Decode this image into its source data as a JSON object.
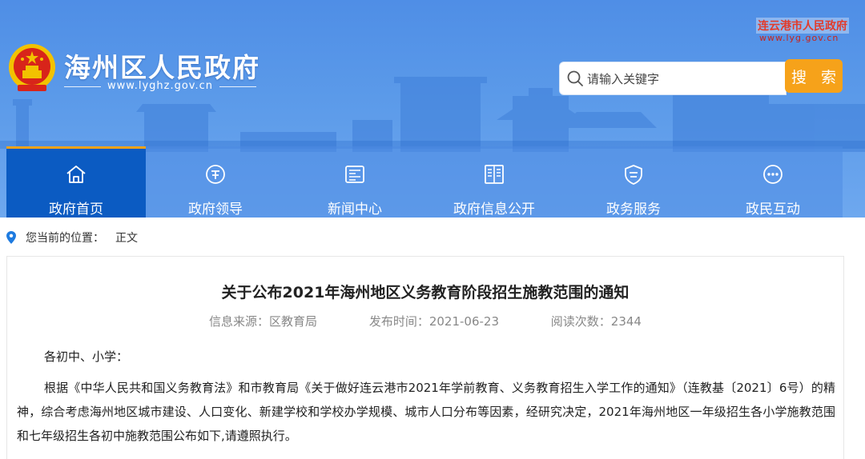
{
  "header": {
    "site_title": "海州区人民政府",
    "site_url": "www.lyghz.gov.cn",
    "city_link": {
      "name": "连云港市人民政府",
      "url": "www.lyg.gov.cn"
    },
    "search": {
      "placeholder": "请输入关键字",
      "button_label": "搜 索"
    }
  },
  "nav": {
    "items": [
      {
        "label": "政府首页",
        "icon": "home-icon",
        "active": true
      },
      {
        "label": "政府领导",
        "icon": "leader-icon"
      },
      {
        "label": "新闻中心",
        "icon": "news-icon"
      },
      {
        "label": "政府信息公开",
        "icon": "info-open-icon"
      },
      {
        "label": "政务服务",
        "icon": "service-shield-icon"
      },
      {
        "label": "政民互动",
        "icon": "chat-icon"
      }
    ]
  },
  "breadcrumb": {
    "prefix": "您当前的位置：",
    "current": "正文"
  },
  "article": {
    "title": "关于公布2021年海州地区义务教育阶段招生施教范围的通知",
    "source": "信息来源：区教育局",
    "date": "发布时间：2021-06-23",
    "views": "阅读次数：2344",
    "greeting": "各初中、小学：",
    "paragraph": "根据《中华人民共和国义务教育法》和市教育局《关于做好连云港市2021年学前教育、义务教育招生入学工作的通知》（连教基〔2021〕6号）的精神，综合考虑海州地区城市建设、人口变化、新建学校和学校办学规模、城市人口分布等因素，经研究决定，2021年海州地区一年级招生各小学施教范围和七年级招生各初中施教范围公布如下,请遵照执行。"
  },
  "colors": {
    "header_blue": "#5b9ae9",
    "nav_active": "#0b5bc2",
    "search_button": "#f6a21a",
    "city_red": "#e23b2b"
  }
}
